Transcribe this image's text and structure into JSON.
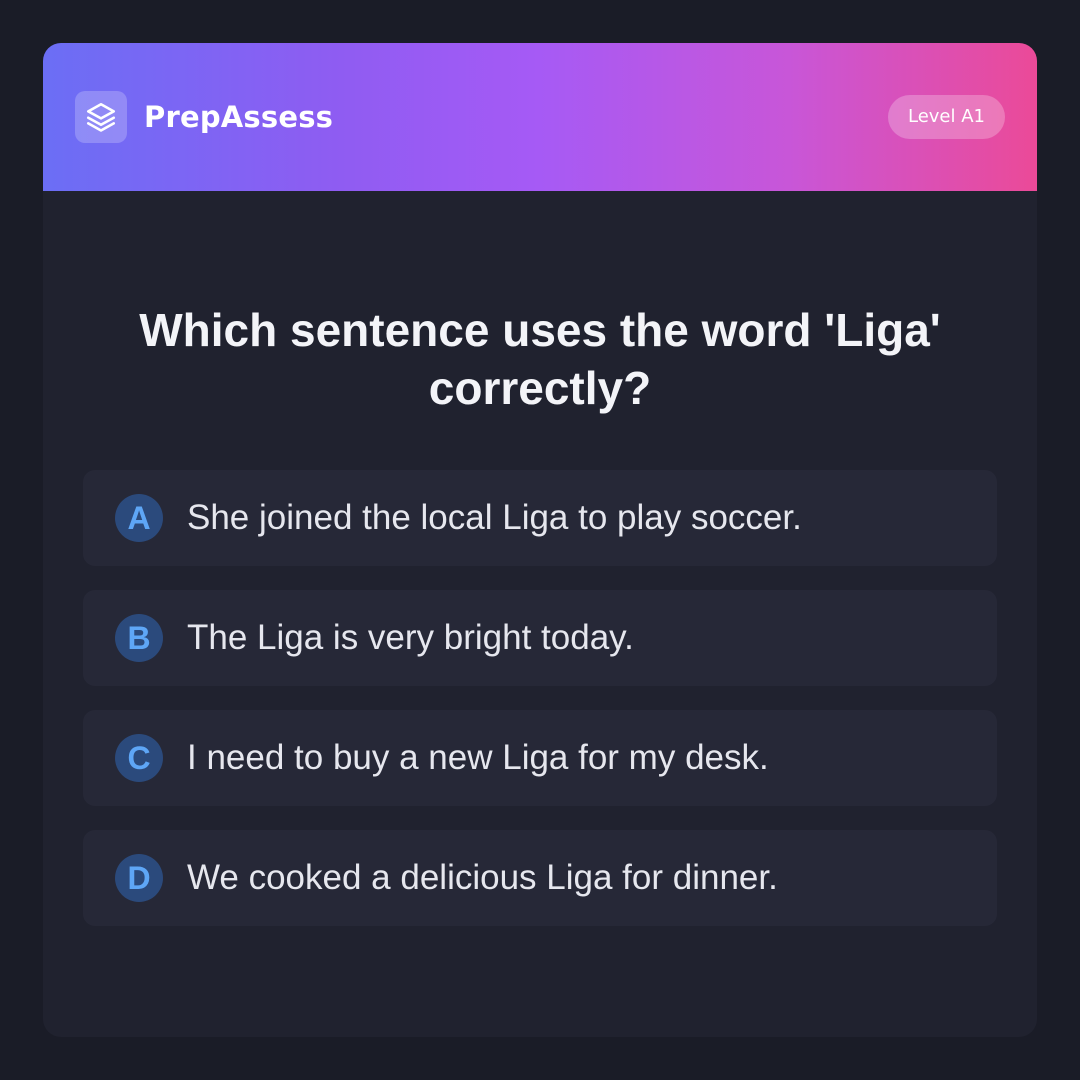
{
  "app": {
    "name": "PrepAssess",
    "level_badge": "Level A1"
  },
  "question": {
    "text": "Which sentence uses the word 'Liga' correctly?"
  },
  "options": [
    {
      "letter": "A",
      "text": "She joined the local Liga to play soccer."
    },
    {
      "letter": "B",
      "text": "The Liga is very bright today."
    },
    {
      "letter": "C",
      "text": "I need to buy a new Liga for my desk."
    },
    {
      "letter": "D",
      "text": "We cooked a delicious Liga for dinner."
    }
  ],
  "icons": {
    "logo": "layers-icon"
  },
  "colors": {
    "background": "#1a1c27",
    "card": "#20222f",
    "option_bg": "#262837",
    "letter_circle": "#2b4a7c",
    "letter_text": "#5ea6f6",
    "gradient_start": "#6b6ef5",
    "gradient_mid": "#a65af5",
    "gradient_end": "#eb4a98"
  }
}
